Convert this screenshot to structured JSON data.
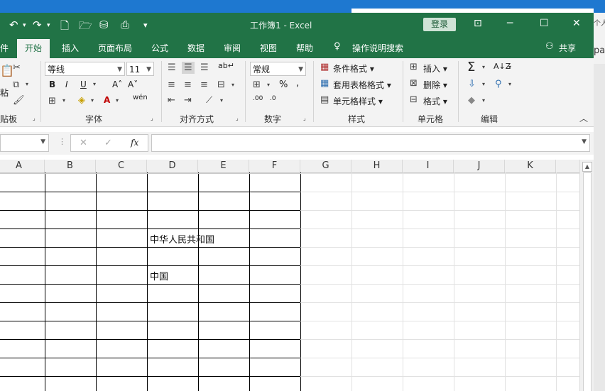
{
  "window": {
    "doc_title": "工作簿1  -  Excel",
    "login_label": "登录"
  },
  "tabs": {
    "file_partial": "件",
    "items": [
      "开始",
      "插入",
      "页面布局",
      "公式",
      "数据",
      "审阅",
      "视图",
      "帮助"
    ],
    "tell_me": "操作说明搜索",
    "share": "共享"
  },
  "ribbon": {
    "clipboard": {
      "label_partial": "贴板",
      "paste_partial": "粘"
    },
    "font": {
      "name": "等线",
      "size": "11",
      "label": "字体"
    },
    "alignment": {
      "label": "对齐方式"
    },
    "number": {
      "format": "常规",
      "label": "数字"
    },
    "styles": {
      "conditional": "条件格式",
      "table": "套用表格格式",
      "cell_styles": "单元格样式",
      "label": "样式"
    },
    "cells": {
      "insert": "插入",
      "delete": "删除",
      "format": "格式",
      "label": "单元格"
    },
    "editing": {
      "label": "编辑"
    }
  },
  "formula_bar": {
    "fx": "fx",
    "value": ""
  },
  "sheet": {
    "columns": [
      "A",
      "B",
      "C",
      "D",
      "E",
      "F",
      "G",
      "H",
      "I",
      "J",
      "K"
    ],
    "cells": [
      {
        "ref": "D4",
        "value": "中华人民共和国"
      },
      {
        "ref": "D6",
        "value": "中国"
      }
    ]
  },
  "desktop": {
    "text1": "个人",
    "text2": "pa"
  },
  "colors": {
    "excel_green": "#217346",
    "ribbon_bg": "#f3f3f3",
    "desktop_blue": "#1e78d0"
  }
}
